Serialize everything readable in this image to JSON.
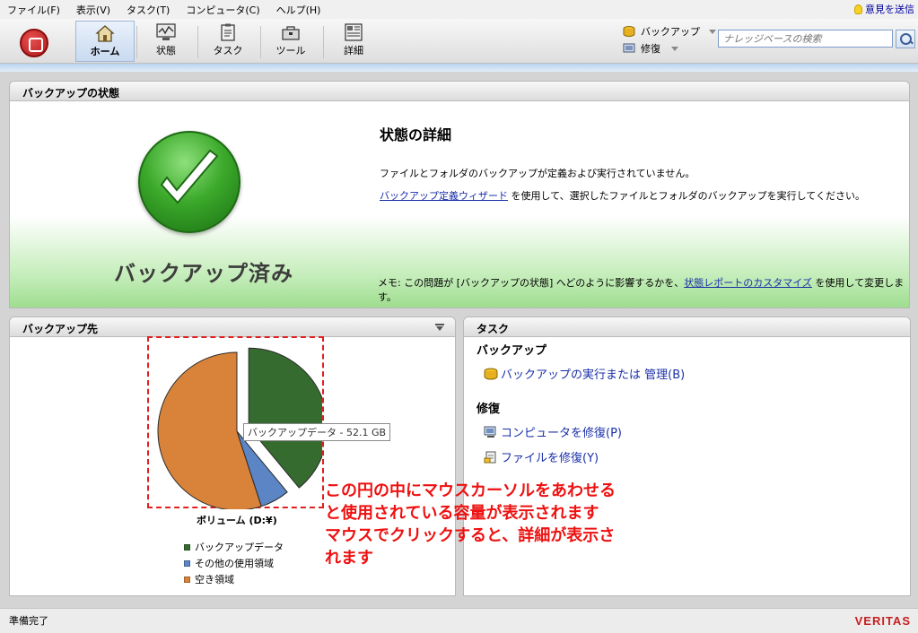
{
  "menu": {
    "items": [
      "ファイル(F)",
      "表示(V)",
      "タスク(T)",
      "コンピュータ(C)",
      "ヘルプ(H)"
    ],
    "feedback": "意見を送信"
  },
  "toolbar": {
    "buttons": [
      {
        "label": "ホーム",
        "icon": "home-icon",
        "active": true
      },
      {
        "label": "状態",
        "icon": "monitor-icon"
      },
      {
        "label": "タスク",
        "icon": "clipboard-icon"
      },
      {
        "label": "ツール",
        "icon": "toolbox-icon"
      },
      {
        "label": "詳細",
        "icon": "details-icon"
      }
    ],
    "backup_menu": "バックアップ",
    "restore_menu": "修復",
    "search_placeholder": "ナレッジベースの検索"
  },
  "status_panel": {
    "title": "バックアップの状態",
    "status_label": "バックアップ済み",
    "detail_title": "状態の詳細",
    "detail_line1": "ファイルとフォルダのバックアップが定義および実行されていません。",
    "detail_link": "バックアップ定義ウィザード",
    "detail_line2_suffix": " を使用して、選択したファイルとフォルダのバックアップを実行してください。",
    "memo_prefix": "メモ: この問題が [バックアップの状態] へどのように影響するかを、",
    "memo_link": "状態レポートのカスタマイズ",
    "memo_suffix": " を使用して変更します。"
  },
  "destination_panel": {
    "title": "バックアップ先",
    "tooltip": "バックアップデータ - 52.1 GB",
    "volume_label": "ボリューム (D:¥)",
    "legend": [
      {
        "label": "バックアップデータ",
        "color": "#356b2f"
      },
      {
        "label": "その他の使用領域",
        "color": "#5b85c4"
      },
      {
        "label": "空き領域",
        "color": "#d9833a"
      }
    ]
  },
  "chart_data": {
    "type": "pie",
    "title": "ボリューム (D:¥)",
    "categories": [
      "バックアップデータ",
      "その他の使用領域",
      "空き領域"
    ],
    "values": [
      39,
      6,
      55
    ],
    "unit": "%",
    "annotations": [
      "バックアップデータ - 52.1 GB"
    ]
  },
  "task_panel": {
    "title": "タスク",
    "backup_section": "バックアップ",
    "backup_action": "バックアップの実行または 管理(B)",
    "restore_section": "修復",
    "restore_computer": "コンピュータを修復(P)",
    "restore_files": "ファイルを修復(Y)"
  },
  "annotation": {
    "line1": "この円の中にマウスカーソルをあわせる",
    "line2": "と使用されている容量が表示されます",
    "line3": "マウスでクリックすると、詳細が表示さ",
    "line4": "れます"
  },
  "statusbar": {
    "text": "準備完了",
    "brand": "VERITAS"
  }
}
